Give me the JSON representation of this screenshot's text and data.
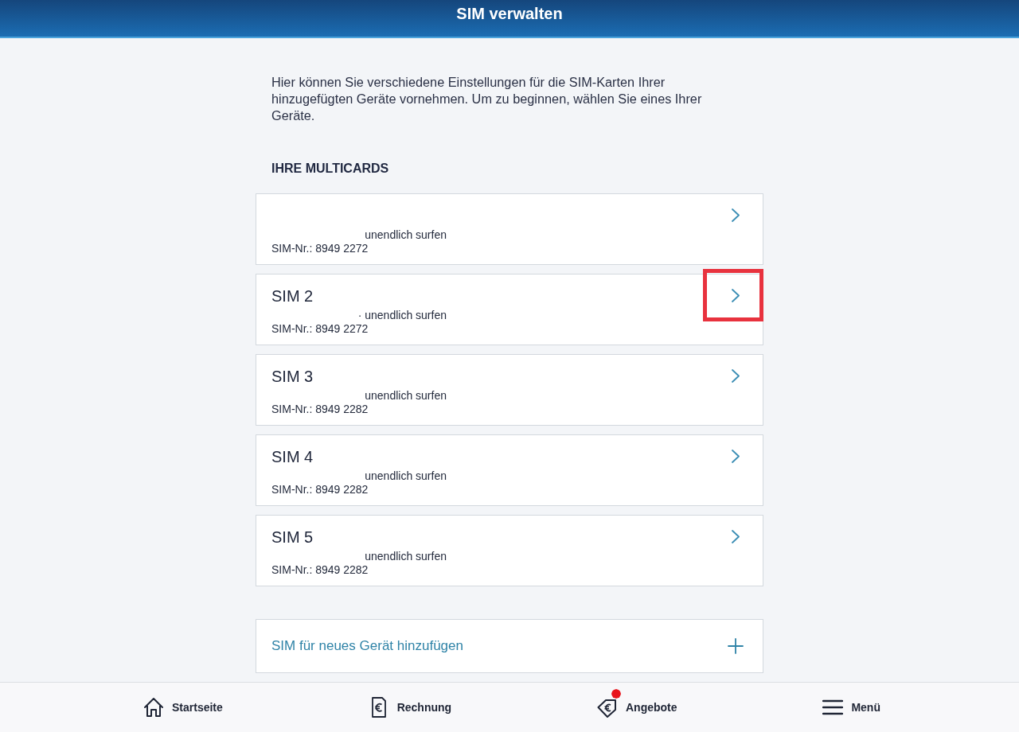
{
  "header": {
    "title": "SIM verwalten"
  },
  "intro": "Hier können Sie verschiedene Einstellungen für die SIM-Karten Ihrer hinzugefügten Geräte vornehmen. Um zu beginnen, wählen Sie eines Ihrer Geräte.",
  "section": {
    "heading": "IHRE MULTICARDS"
  },
  "cards": [
    {
      "plan": "unendlich surfen",
      "sim_number": "SIM-Nr.: 8949 2272",
      "highlighted": false
    },
    {
      "title": "SIM 2",
      "plan": "· unendlich surfen",
      "sim_number": "SIM-Nr.: 8949 2272",
      "highlighted": true
    },
    {
      "title": "SIM 3",
      "plan": "unendlich surfen",
      "sim_number": "SIM-Nr.: 8949 2282",
      "highlighted": false
    },
    {
      "title": "SIM 4",
      "plan": "unendlich surfen",
      "sim_number": "SIM-Nr.: 8949 2282",
      "highlighted": false
    },
    {
      "title": "SIM 5",
      "plan": "unendlich surfen",
      "sim_number": "SIM-Nr.: 8949 2282",
      "highlighted": false
    }
  ],
  "add_action": {
    "label": "SIM für neues Gerät hinzufügen"
  },
  "nav": [
    {
      "kind": "home",
      "label": "Startseite",
      "notification": false
    },
    {
      "kind": "invoice",
      "label": "Rechnung",
      "notification": false
    },
    {
      "kind": "offers",
      "label": "Angebote",
      "notification": true
    },
    {
      "kind": "menu",
      "label": "Menü",
      "notification": false
    }
  ]
}
